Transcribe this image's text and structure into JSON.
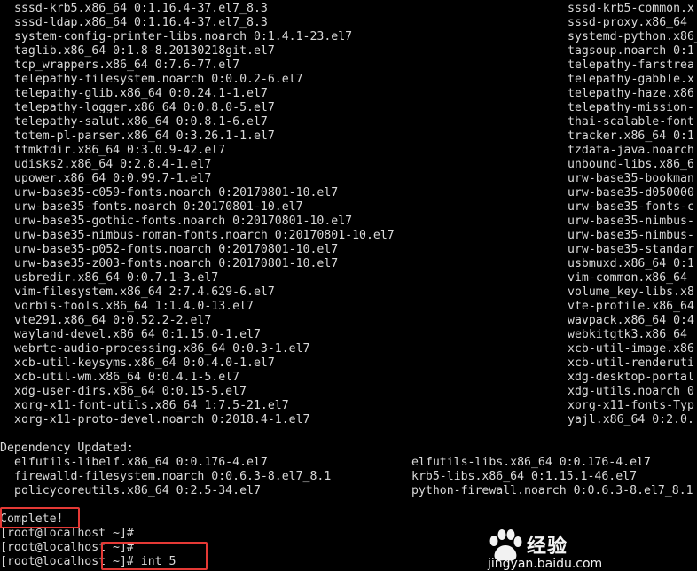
{
  "terminal": {
    "left_lines": [
      "sssd-krb5.x86_64 0:1.16.4-37.el7_8.3",
      "sssd-ldap.x86_64 0:1.16.4-37.el7_8.3",
      "system-config-printer-libs.noarch 0:1.4.1-23.el7",
      "taglib.x86_64 0:1.8-8.20130218git.el7",
      "tcp_wrappers.x86_64 0:7.6-77.el7",
      "telepathy-filesystem.noarch 0:0.0.2-6.el7",
      "telepathy-glib.x86_64 0:0.24.1-1.el7",
      "telepathy-logger.x86_64 0:0.8.0-5.el7",
      "telepathy-salut.x86_64 0:0.8.1-6.el7",
      "totem-pl-parser.x86_64 0:3.26.1-1.el7",
      "ttmkfdir.x86_64 0:3.0.9-42.el7",
      "udisks2.x86_64 0:2.8.4-1.el7",
      "upower.x86_64 0:0.99.7-1.el7",
      "urw-base35-c059-fonts.noarch 0:20170801-10.el7",
      "urw-base35-fonts.noarch 0:20170801-10.el7",
      "urw-base35-gothic-fonts.noarch 0:20170801-10.el7",
      "urw-base35-nimbus-roman-fonts.noarch 0:20170801-10.el7",
      "urw-base35-p052-fonts.noarch 0:20170801-10.el7",
      "urw-base35-z003-fonts.noarch 0:20170801-10.el7",
      "usbredir.x86_64 0:0.7.1-3.el7",
      "vim-filesystem.x86_64 2:7.4.629-6.el7",
      "vorbis-tools.x86_64 1:1.4.0-13.el7",
      "vte291.x86_64 0:0.52.2-2.el7",
      "wayland-devel.x86_64 0:1.15.0-1.el7",
      "webrtc-audio-processing.x86_64 0:0.3-1.el7",
      "xcb-util-keysyms.x86_64 0:0.4.0-1.el7",
      "xcb-util-wm.x86_64 0:0.4.1-5.el7",
      "xdg-user-dirs.x86_64 0:0.15-5.el7",
      "xorg-x11-font-utils.x86_64 1:7.5-21.el7",
      "xorg-x11-proto-devel.noarch 0:2018.4-1.el7"
    ],
    "right_lines": [
      "sssd-krb5-common.x",
      "sssd-proxy.x86_64 ",
      "systemd-python.x86_",
      "tagsoup.noarch 0:1",
      "telepathy-farstrea",
      "telepathy-gabble.x",
      "telepathy-haze.x86",
      "telepathy-mission-",
      "thai-scalable-font",
      "tracker.x86_64 0:1",
      "tzdata-java.noarch",
      "unbound-libs.x86_6",
      "urw-base35-bookman",
      "urw-base35-d050000",
      "urw-base35-fonts-c",
      "urw-base35-nimbus-",
      "urw-base35-nimbus-",
      "urw-base35-standar",
      "usbmuxd.x86_64 0:1",
      "vim-common.x86_64 ",
      "volume_key-libs.x8",
      "vte-profile.x86_64",
      "wavpack.x86_64 0:4",
      "webkitgtk3.x86_64 ",
      "xcb-util-image.x86",
      "xcb-util-renderuti",
      "xdg-desktop-portal",
      "xdg-utils.noarch 0",
      "xorg-x11-fonts-Typ",
      "yajl.x86_64 0:2.0."
    ],
    "dep_header": "Dependency Updated:",
    "dep_left": [
      "elfutils-libelf.x86_64 0:0.176-4.el7",
      "firewalld-filesystem.noarch 0:0.6.3-8.el7_8.1",
      "policycoreutils.x86_64 0:2.5-34.el7"
    ],
    "dep_right": [
      "elfutils-libs.x86_64 0:0.176-4.el7",
      "krb5-libs.x86_64 0:1.15.1-46.el7",
      "python-firewall.noarch 0:0.6.3-8.el7_8.1"
    ],
    "complete": "Complete!",
    "prompts": [
      "[root@localhost ~]#",
      "[root@localhost ~]#",
      "[root@localhost ~]# int 5"
    ]
  },
  "watermark": {
    "brand": "经验",
    "url": "jingyan.baidu.com"
  },
  "colors": {
    "background": "#000000",
    "text": "#d9d9d9",
    "highlight": "#e53935"
  }
}
